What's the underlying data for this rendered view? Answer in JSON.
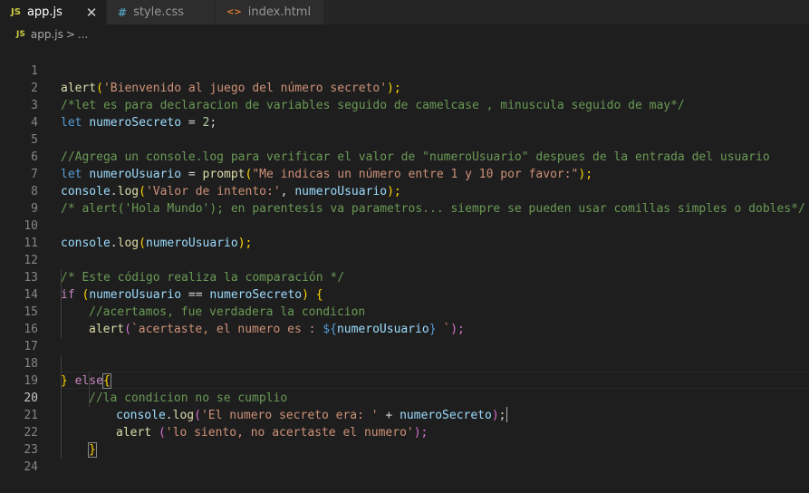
{
  "tabs": [
    {
      "icon": "JS",
      "label": "app.js",
      "active": true
    },
    {
      "icon": "#",
      "label": "style.css",
      "active": false
    },
    {
      "icon": "<>",
      "label": "index.html",
      "active": false
    }
  ],
  "breadcrumb": {
    "icon": "JS",
    "file": "app.js",
    "separator": ">",
    "rest": "..."
  },
  "line_numbers": [
    "1",
    "2",
    "3",
    "4",
    "5",
    "6",
    "7",
    "8",
    "9",
    "10",
    "11",
    "12",
    "13",
    "14",
    "15",
    "16",
    "17",
    "18",
    "19",
    "20",
    "21",
    "22",
    "23",
    "24"
  ],
  "tokens": {
    "l1": [
      "alert",
      "(",
      "'Bienvenido al juego del número secreto'",
      ");"
    ],
    "l2": [
      "/*let es para declaracion de variables seguido de camelcase , minuscula seguido de may*/"
    ],
    "l3": [
      "let",
      " ",
      "numeroSecreto",
      " = ",
      "2",
      ";"
    ],
    "l5": [
      "//Agrega un console.log para verificar el valor de \"numeroUsuario\" despues de la entrada del usuario"
    ],
    "l6": [
      "let",
      " ",
      "numeroUsuario",
      " = ",
      "prompt",
      "(",
      "\"Me indicas un número entre 1 y 10 por favor:\"",
      ");"
    ],
    "l7": [
      "console",
      ".",
      "log",
      "(",
      "'Valor de intento:'",
      ", ",
      "numeroUsuario",
      ");"
    ],
    "l8": [
      "/* alert('Hola Mundo'); en parentesis va parametros... siempre se pueden usar comillas simples o dobles*/"
    ],
    "l10": [
      "console",
      ".",
      "log",
      "(",
      "numeroUsuario",
      ");"
    ],
    "l12": [
      "/* Este código realiza la comparación */"
    ],
    "l13": [
      "if",
      " ",
      "(",
      "numeroUsuario",
      " == ",
      "numeroSecreto",
      ")",
      " ",
      "{"
    ],
    "l14": [
      "//acertamos, fue verdadera la condicion"
    ],
    "l15": [
      "alert",
      "(",
      "`acertaste, el numero es : ",
      "${",
      "numeroUsuario",
      "}",
      " `",
      ");"
    ],
    "l18": [
      "}",
      " ",
      "else",
      "{"
    ],
    "l19": [
      "//la condicion no se cumplio"
    ],
    "l20": [
      "console",
      ".",
      "log",
      "(",
      "'El numero secreto era: '",
      " + ",
      "numeroSecreto",
      ")",
      ";"
    ],
    "l21": [
      "alert",
      " ",
      "(",
      "'lo siento, no acertaste el numero'",
      ");"
    ],
    "l22": [
      "}"
    ]
  },
  "colors": {
    "background": "#1e1e1e",
    "function": "#dcdcaa",
    "string": "#ce9178",
    "comment": "#6a9955",
    "keyword": "#569cd6",
    "variable": "#9cdcfe",
    "control": "#c586c0",
    "number": "#b5cea8"
  }
}
